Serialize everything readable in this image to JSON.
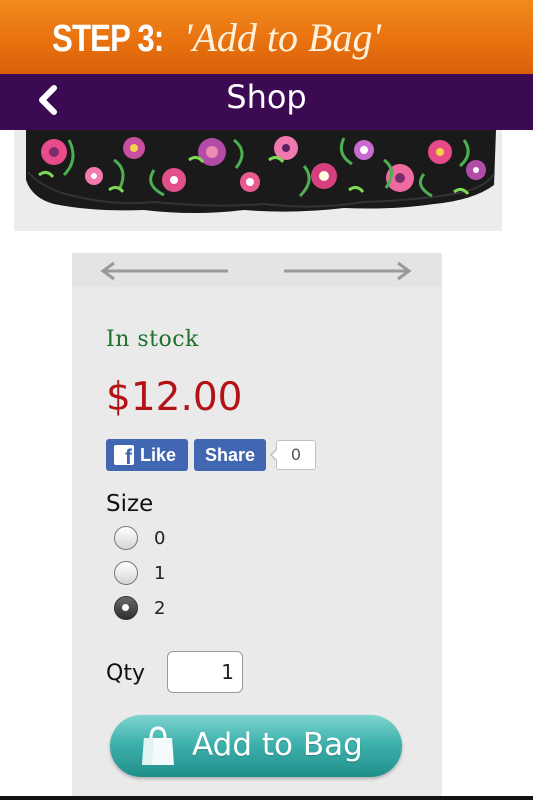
{
  "banner": {
    "step_label": "STEP 3:",
    "step_action": "'Add to Bag'"
  },
  "header": {
    "title": "Shop",
    "back_icon": "chevron-left-icon"
  },
  "product": {
    "stock_status": "In stock",
    "price": "$12.00"
  },
  "social": {
    "like_label": "Like",
    "share_label": "Share",
    "share_count": "0"
  },
  "size": {
    "label": "Size",
    "options": [
      "0",
      "1",
      "2"
    ],
    "selected": "2"
  },
  "quantity": {
    "label": "Qty",
    "value": "1"
  },
  "cart": {
    "add_label": "Add to Bag"
  },
  "colors": {
    "banner": "#e8720f",
    "header": "#3c0a52",
    "stock": "#1e6f2a",
    "price": "#b31217",
    "facebook": "#4267b2",
    "add_button": "#3fb2ad"
  }
}
